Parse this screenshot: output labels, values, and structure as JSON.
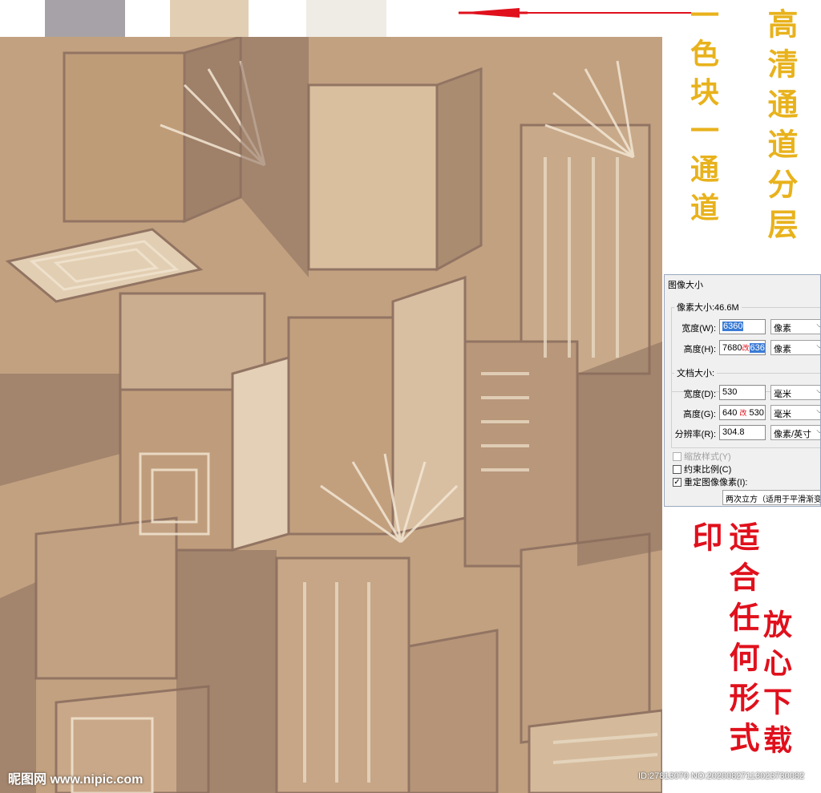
{
  "swatch_colors": [
    "#a7a2a7",
    "#e2cfb3",
    "#efece6"
  ],
  "accent_colors": {
    "gold": "#e8b21c",
    "red": "#e0101c",
    "arrow": "#e0101c"
  },
  "side_text": {
    "gold_left": "一色块一通道",
    "gold_right": "高清通道分层",
    "red_left": "适合任何形式印",
    "red_right": "放心下载"
  },
  "dialog": {
    "title": "图像大小",
    "pixel_dimensions": {
      "label": "像素大小:46.6M",
      "width_label": "宽度(W):",
      "width_value": "6360",
      "width_unit": "像素",
      "height_label": "高度(H):",
      "height_value_old": "7680",
      "height_mark": "改",
      "height_value_new": "6360",
      "height_unit": "像素"
    },
    "document_size": {
      "label": "文档大小:",
      "width_label": "宽度(D):",
      "width_value": "530",
      "width_unit": "毫米",
      "height_label": "高度(G):",
      "height_value_old": "640",
      "height_mark": "改",
      "height_value_new": "530",
      "height_unit": "毫米",
      "resolution_label": "分辨率(R):",
      "resolution_value": "304.8",
      "resolution_unit": "像素/英寸"
    },
    "checkboxes": {
      "scale_styles": "缩放样式(Y)",
      "constrain_proportions": "约束比例(C)",
      "resample_image": "重定图像像素(I):"
    },
    "resample_method": "两次立方（适用于平滑渐变"
  },
  "watermarks": {
    "left": "昵图网 www.nipic.com",
    "right": "ID:27813070 NO:20200827113023730082"
  }
}
